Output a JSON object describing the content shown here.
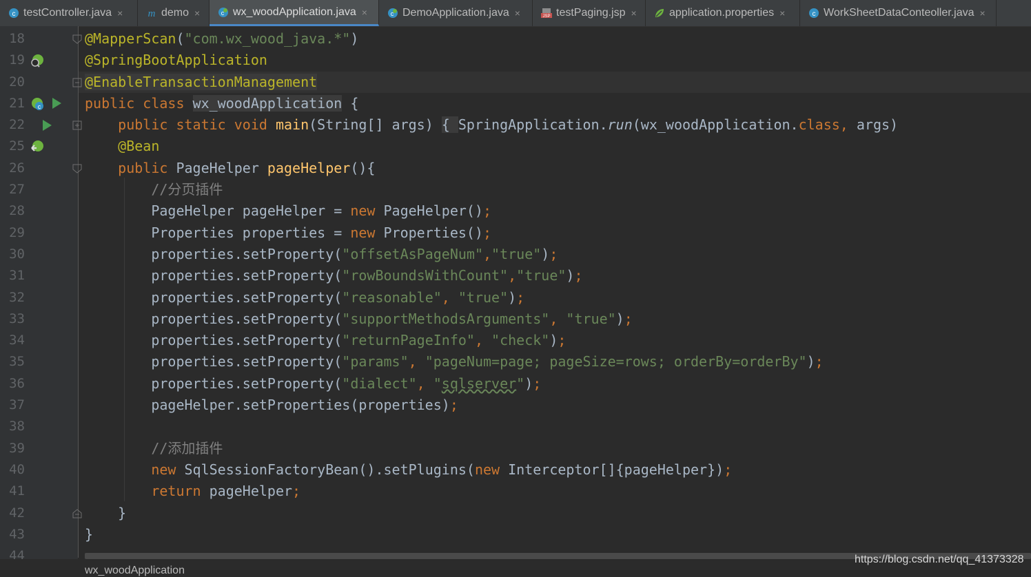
{
  "tabs": [
    {
      "label": "testController.java",
      "icon": "java-class-icon"
    },
    {
      "label": "demo",
      "icon": "maven-module-icon"
    },
    {
      "label": "wx_woodApplication.java",
      "icon": "spring-boot-class-icon",
      "active": true
    },
    {
      "label": "DemoApplication.java",
      "icon": "spring-boot-class-icon"
    },
    {
      "label": "testPaging.jsp",
      "icon": "jsp-file-icon"
    },
    {
      "label": "application.properties",
      "icon": "spring-properties-icon"
    },
    {
      "label": "WorkSheetDataConteoller.java",
      "icon": "java-class-icon"
    }
  ],
  "tab_close_glyph": "×",
  "line_numbers": [
    "18",
    "19",
    "20",
    "21",
    "22",
    "25",
    "26",
    "27",
    "28",
    "29",
    "30",
    "31",
    "32",
    "33",
    "34",
    "35",
    "36",
    "37",
    "38",
    "39",
    "40",
    "41",
    "42",
    "43",
    "44"
  ],
  "code": {
    "l18_annotation": "@MapperScan",
    "l18_str": "\"com.wx_wood_java.*\"",
    "l19_annotation": "@SpringBootApplication",
    "l20_annotation": "@EnableTransactionManagement",
    "l21_kw": "public class ",
    "l21_class": "wx_woodApplication",
    "l21_rest": " {",
    "l22_kw": "public static void ",
    "l22_method": "main",
    "l22_params": "(String[] args) ",
    "l22_fold": "{ ",
    "l22_call": "SpringApplication.",
    "l22_run": "run",
    "l22_arg": "(wx_woodApplication.",
    "l22_class_kw": "class",
    "l22_comma": ", ",
    "l22_args": "args)",
    "l25_annotation": "@Bean",
    "l26_kw": "public ",
    "l26_type": "PageHelper ",
    "l26_method": "pageHelper",
    "l26_rest": "(){",
    "l27_comment": "//分页插件",
    "l28_a": "PageHelper pageHelper = ",
    "l28_new": "new ",
    "l28_b": "PageHelper()",
    "l28_semi": ";",
    "l29_a": "Properties properties = ",
    "l29_new": "new ",
    "l29_b": "Properties()",
    "l29_semi": ";",
    "set_prop": "properties.setProperty(",
    "l30_s1": "\"offsetAsPageNum\"",
    "l30_comma": ",",
    "l30_s2": "\"true\"",
    "l31_s1": "\"rowBoundsWithCount\"",
    "l31_comma": ",",
    "l31_s2": "\"true\"",
    "l32_s1": "\"reasonable\"",
    "l32_comma": ", ",
    "l32_s2": "\"true\"",
    "l33_s1": "\"supportMethodsArguments\"",
    "l33_comma": ", ",
    "l33_s2": "\"true\"",
    "l34_s1": "\"returnPageInfo\"",
    "l34_comma": ", ",
    "l34_s2": "\"check\"",
    "l35_s1": "\"params\"",
    "l35_comma": ", ",
    "l35_s2": "\"pageNum=page; pageSize=rows; orderBy=orderBy\"",
    "l36_s1": "\"dialect\"",
    "l36_comma": ", ",
    "l36_q1": "\"",
    "l36_s2": "sqlserver",
    "l36_q2": "\"",
    "close_semi": ");",
    "close_paren": ")",
    "semi": ";",
    "l37_a": "pageHelper.setProperties(properties)",
    "l37_semi": ";",
    "l39_comment": "//添加插件",
    "l40_new1": "new ",
    "l40_a": "SqlSessionFactoryBean().setPlugins(",
    "l40_new2": "new ",
    "l40_b": "Interceptor[]{pageHelper})",
    "l40_semi": ";",
    "l41_kw": "return ",
    "l41_a": "pageHelper",
    "l41_semi": ";",
    "l42_brace": "}",
    "l43_brace": "}"
  },
  "breadcrumb": "wx_woodApplication",
  "watermark": "https://blog.csdn.net/qq_41373328",
  "colors": {
    "keyword": "#cc7832",
    "annotation": "#bbb529",
    "string": "#6a8759",
    "comment": "#808080",
    "method": "#ffc66d",
    "text": "#a9b7c6",
    "accent": "#4a88c7"
  }
}
